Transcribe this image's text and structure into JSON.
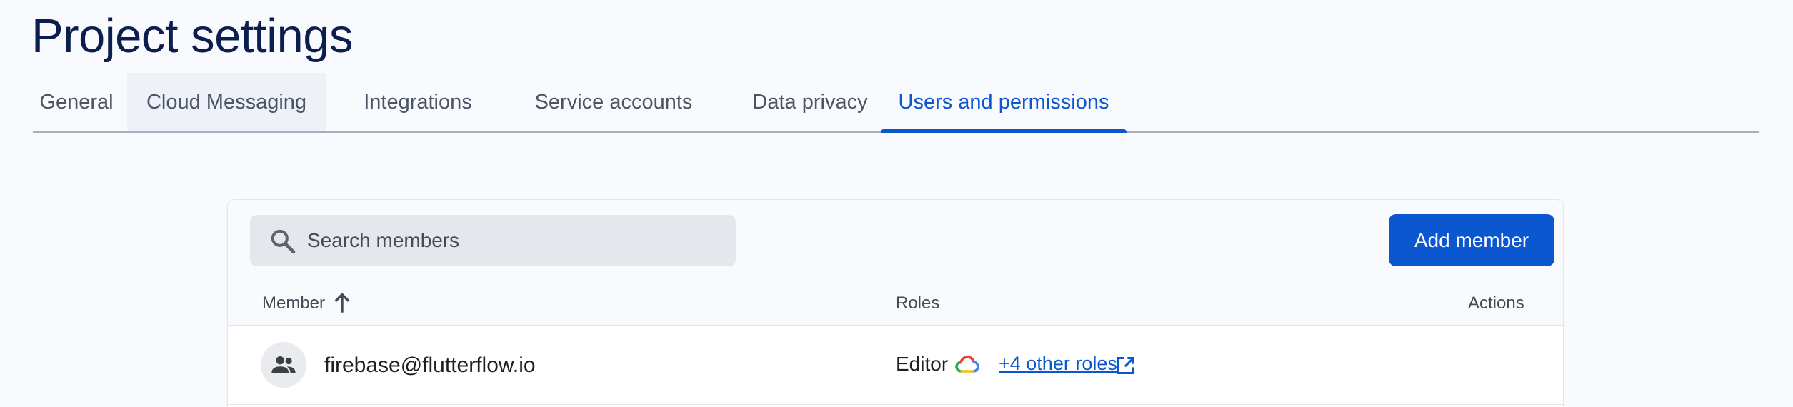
{
  "page": {
    "title": "Project settings"
  },
  "tabs": [
    {
      "label": "General",
      "state": "default"
    },
    {
      "label": "Cloud Messaging",
      "state": "hover"
    },
    {
      "label": "Integrations",
      "state": "default"
    },
    {
      "label": "Service accounts",
      "state": "default"
    },
    {
      "label": "Data privacy",
      "state": "default"
    },
    {
      "label": "Users and permissions",
      "state": "active"
    }
  ],
  "members_panel": {
    "search": {
      "placeholder": "Search members",
      "value": "",
      "icon": "search-icon"
    },
    "add_member_label": "Add member",
    "columns": {
      "member": "Member",
      "member_sort": "ascending",
      "roles": "Roles",
      "actions": "Actions"
    },
    "rows": [
      {
        "avatar_icon": "group-icon",
        "email": "firebase@flutterflow.io",
        "role": "Editor",
        "role_source_icon": "google-cloud-icon",
        "other_roles": "+4 other roles",
        "link_icon": "open-in-new-icon"
      }
    ]
  },
  "colors": {
    "accent": "#0b57d0",
    "title": "#0c1e4e",
    "background": "#f8fafd"
  }
}
